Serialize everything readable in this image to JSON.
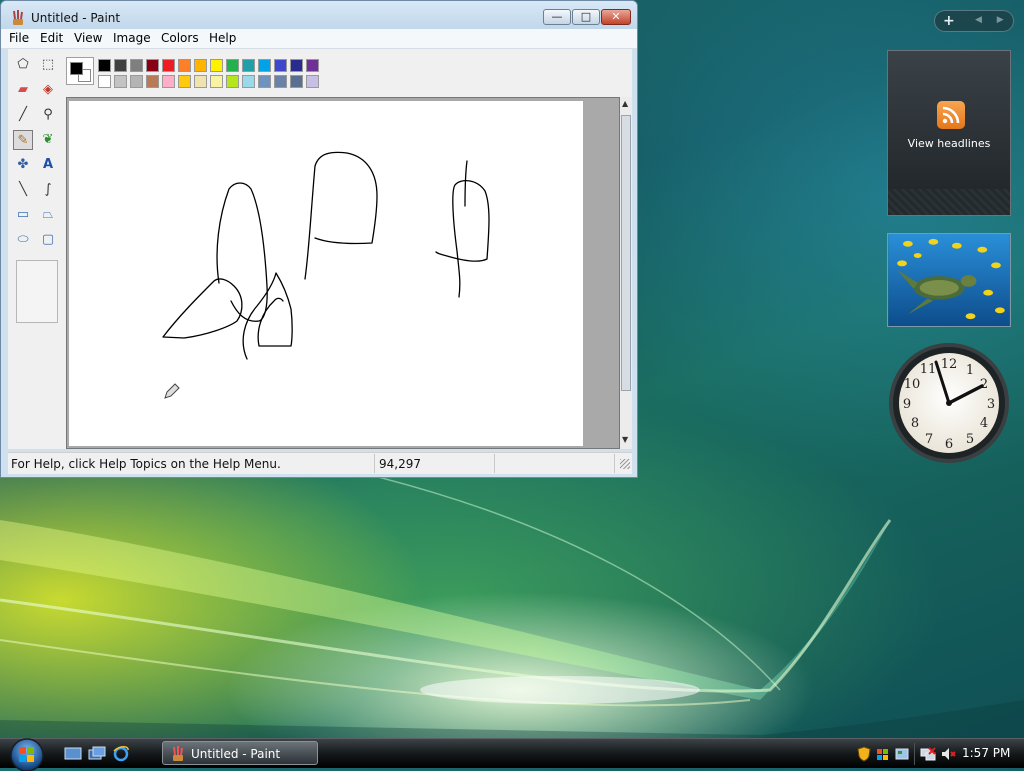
{
  "window": {
    "title": "Untitled - Paint",
    "minimize_symbol": "—",
    "maximize_symbol": "□",
    "close_symbol": "✕",
    "icon": "paint-icon"
  },
  "menu": [
    "File",
    "Edit",
    "View",
    "Image",
    "Colors",
    "Help"
  ],
  "tools": [
    {
      "name": "free-form-select",
      "glyph": "⬠"
    },
    {
      "name": "select",
      "glyph": "⬚"
    },
    {
      "name": "eraser",
      "glyph": "▰"
    },
    {
      "name": "fill-with-color",
      "glyph": "◈"
    },
    {
      "name": "pick-color",
      "glyph": "╱"
    },
    {
      "name": "magnifier",
      "glyph": "⚲"
    },
    {
      "name": "pencil",
      "glyph": "✎"
    },
    {
      "name": "brush",
      "glyph": "❦"
    },
    {
      "name": "airbrush",
      "glyph": "✤"
    },
    {
      "name": "text",
      "glyph": "A"
    },
    {
      "name": "line",
      "glyph": "╲"
    },
    {
      "name": "curve",
      "glyph": "∫"
    },
    {
      "name": "rectangle",
      "glyph": "▭"
    },
    {
      "name": "polygon",
      "glyph": "⏢"
    },
    {
      "name": "ellipse",
      "glyph": "⬭"
    },
    {
      "name": "rounded-rectangle",
      "glyph": "▢"
    }
  ],
  "selected_tool": "pencil",
  "palette": {
    "foreground": "#000000",
    "background": "#ffffff",
    "row1": [
      "#000000",
      "#404040",
      "#7f7f7f",
      "#880015",
      "#ed1c24",
      "#ff7f27",
      "#ffb400",
      "#fff200",
      "#22b14c",
      "#1fa0a8",
      "#00a2e8",
      "#3f48cc",
      "#292b8f",
      "#6f3198"
    ],
    "row2": [
      "#ffffff",
      "#c3c3c3",
      "#b4b4b4",
      "#b97a57",
      "#ffaec9",
      "#ffc90e",
      "#efe4b0",
      "#f7f3a0",
      "#b5e61d",
      "#99d9ea",
      "#7092be",
      "#6a82a8",
      "#5a6e90",
      "#c8bfe7"
    ]
  },
  "status": {
    "help_text": "For Help, click Help Topics on the Help Menu.",
    "coordinates": "94,297"
  },
  "sidebar": {
    "add_symbol": "+",
    "nav_symbols": "◀ ▶",
    "feed_label": "View headlines",
    "feed_icon": "rss-icon"
  },
  "taskbar": {
    "task_label": "Untitled - Paint",
    "time": "1:57 PM"
  }
}
